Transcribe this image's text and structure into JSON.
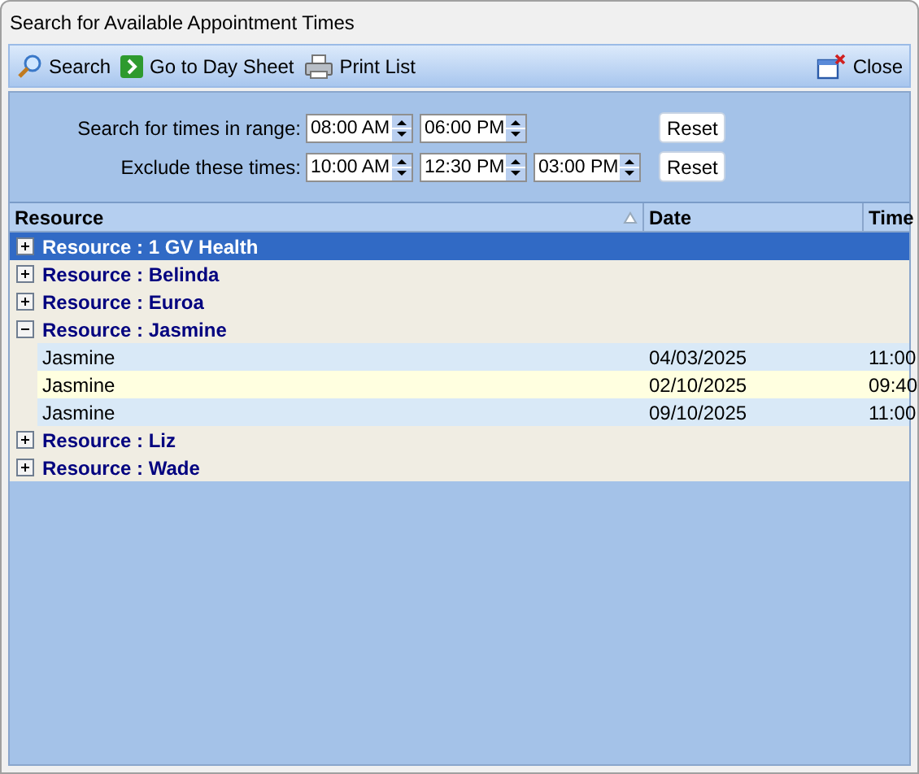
{
  "window": {
    "title": "Search for Available Appointment Times"
  },
  "toolbar": {
    "left": [
      {
        "kind": "search",
        "label": "Search"
      },
      {
        "kind": "goto",
        "label": "Go to Day Sheet"
      },
      {
        "kind": "print",
        "label": "Print List"
      }
    ],
    "right": [
      {
        "kind": "close",
        "label": "Close"
      }
    ]
  },
  "filters": [
    {
      "label": "Search for times in range:",
      "times": [
        "08:00 AM",
        "06:00 PM"
      ],
      "button": "Reset"
    },
    {
      "label": "Exclude these times:",
      "times": [
        "10:00 AM",
        "12:30 PM",
        "03:00 PM"
      ],
      "button": "Reset"
    }
  ],
  "table": {
    "columns": [
      {
        "label": "Resource",
        "sorted": true
      },
      {
        "label": "Date",
        "sorted": false
      },
      {
        "label": "Time",
        "sorted": false
      }
    ],
    "groups": [
      {
        "label": "Resource : 1 GV Health",
        "expanded": false,
        "selected": true
      },
      {
        "label": "Resource : Belinda",
        "expanded": false,
        "selected": false
      },
      {
        "label": "Resource : Euroa",
        "expanded": false,
        "selected": false
      },
      {
        "label": "Resource : Jasmine",
        "expanded": true,
        "selected": false,
        "rows": [
          {
            "cells": [
              "Jasmine",
              "04/03/2025",
              "11:00"
            ]
          },
          {
            "cells": [
              "Jasmine",
              "02/10/2025",
              "09:40"
            ]
          },
          {
            "cells": [
              "Jasmine",
              "09/10/2025",
              "11:00"
            ]
          }
        ]
      },
      {
        "label": "Resource : Liz",
        "expanded": false,
        "selected": false
      },
      {
        "label": "Resource : Wade",
        "expanded": false,
        "selected": false
      }
    ]
  }
}
